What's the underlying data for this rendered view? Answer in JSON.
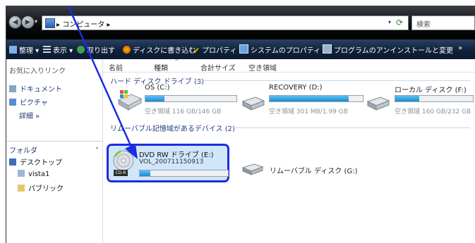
{
  "address": {
    "path": "▸ コンピュータ ▸",
    "search_placeholder": "検索"
  },
  "toolbar": [
    {
      "label": "整理 ▾",
      "icon": "organize-icon"
    },
    {
      "label": "表示 ▾",
      "icon": "views-icon"
    },
    {
      "label": "取り出す",
      "icon": "eject-icon"
    },
    {
      "label": "ディスクに書き込む",
      "icon": "burn-icon"
    },
    {
      "label": "プロパティ",
      "icon": "properties-icon"
    },
    {
      "label": "システムのプロパティ",
      "icon": "system-properties-icon"
    },
    {
      "label": "プログラムのアンインストールと変更",
      "icon": "uninstall-icon"
    },
    {
      "label": "»",
      "icon": "more-icon"
    }
  ],
  "nav": {
    "favorites_header": "お気に入りリンク",
    "favorites": [
      "ドキュメント",
      "ピクチャ"
    ],
    "more": "詳細 »",
    "folders_header": "フォルダ",
    "folders": [
      "デスクトップ",
      "vista1",
      "パブリック"
    ]
  },
  "columns": [
    "名前",
    "種類",
    "合計サイズ",
    "空き領域"
  ],
  "groups": {
    "hdd": "ハード ディスク ドライブ (3)",
    "removable": "リムーバブル記憶域があるデバイス (2)"
  },
  "drives": [
    {
      "name": "OS (C:)",
      "free": "空き領域 116 GB/146 GB",
      "used": 0.21
    },
    {
      "name": "RECOVERY (D:)",
      "free": "空き領域 301 MB/1.99 GB",
      "used": 0.85
    },
    {
      "name": "ローカル ディスク (F:)",
      "free": "空き領域 160 GB/232 GB",
      "used": 0.31
    }
  ],
  "dvd": {
    "name": "DVD RW ドライブ (E:)",
    "volume": "VOL_200711150913",
    "badge": "CD-R",
    "used": 0.12
  },
  "removable_disk": {
    "name": "リムーバブル ディスク (G:)"
  },
  "colors": {
    "highlight": "#1b2ee0",
    "arrow": "#1b2ee0",
    "bar": "#1a8bd6"
  }
}
